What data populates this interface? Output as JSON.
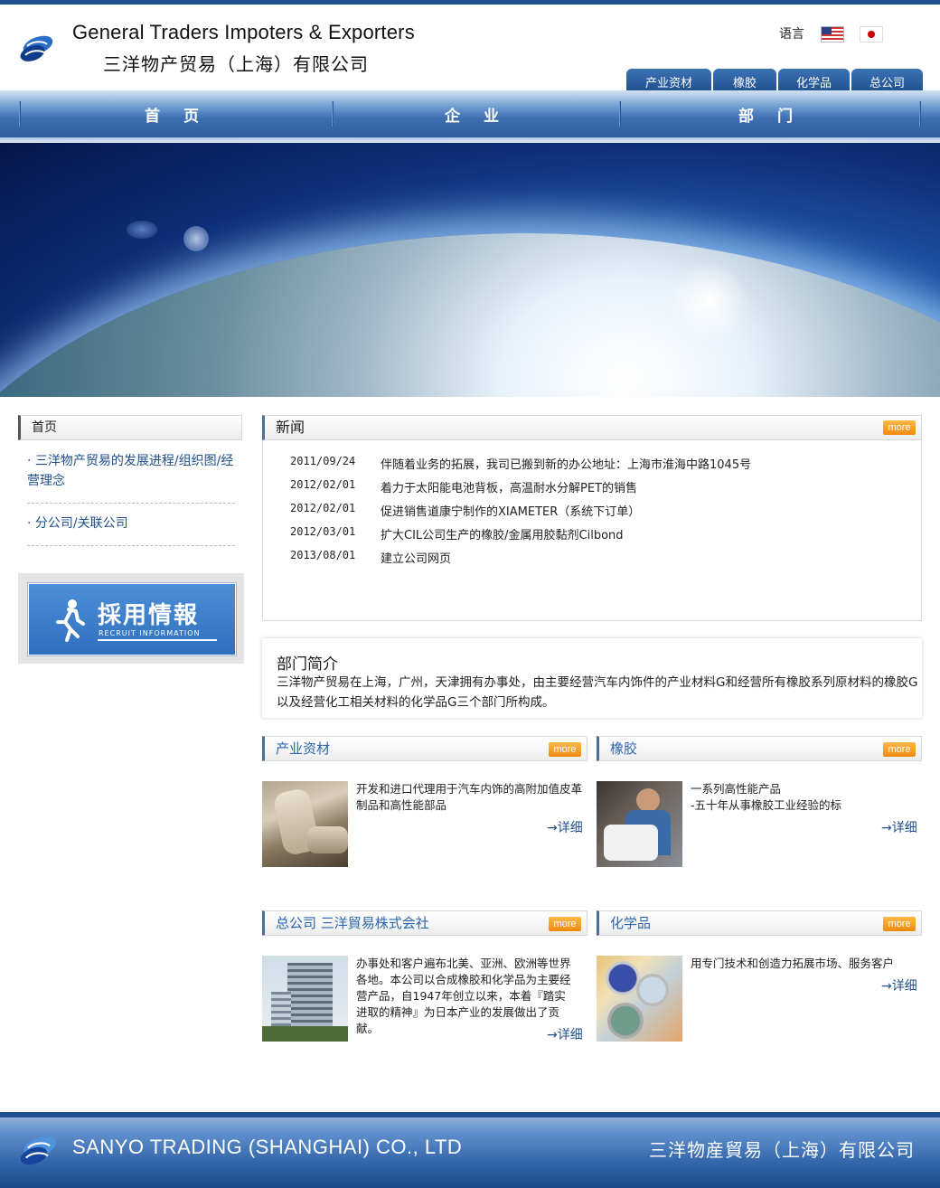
{
  "header": {
    "title_en": "General Traders Impoters & Exporters",
    "title_cn": "三洋物产贸易（上海）有限公司",
    "lang_label": "语言",
    "tabs": [
      "产业资材",
      "橡胶",
      "化学品",
      "总公司"
    ]
  },
  "nav": {
    "items": [
      "首 页",
      "企 业",
      "部 门"
    ]
  },
  "sidebar": {
    "heading": "首页",
    "links": [
      "· 三洋物产贸易的发展进程/组织图/经营理念",
      "· 分公司/关联公司"
    ],
    "recruit_title": "採用情報",
    "recruit_sub": "RECRUIT INFORMATION"
  },
  "news": {
    "heading": "新闻",
    "more": "more",
    "items": [
      {
        "date": "2011/09/24",
        "text": "伴随着业务的拓展，我司已搬到新的办公地址：上海市淮海中路1045号"
      },
      {
        "date": "2012/02/01",
        "text": "着力于太阳能电池背板，高温耐水分解PET的销售"
      },
      {
        "date": "2012/02/01",
        "text": "促进销售道康宁制作的XIAMETER（系统下订单）"
      },
      {
        "date": "2012/03/01",
        "text": "扩大CIL公司生产的橡胶/金属用胶黏剂Cilbond"
      },
      {
        "date": "2013/08/01",
        "text": "建立公司网页"
      }
    ]
  },
  "dept": {
    "title": "部门简介",
    "body": "三洋物产贸易在上海，广州，天津拥有办事处，由主要经营汽车内饰件的产业材料G和经营所有橡胶系列原材料的橡胶G以及经营化工相关材料的化学品G三个部门所构成。"
  },
  "sections": [
    {
      "title": "产业资材",
      "more": "more",
      "text": "开发和进口代理用于汽车内饰的高附加值皮革制品和高性能部品",
      "detail": "→详细"
    },
    {
      "title": "橡胶",
      "more": "more",
      "text": "一系列高性能产品\n-五十年从事橡胶工业经验的标",
      "detail": "→详细"
    },
    {
      "title": "总公司  三洋貿易株式会社",
      "more": "more",
      "text": "办事处和客户遍布北美、亚洲、欧洲等世界各地。本公司以合成橡胶和化学品为主要经营产品，自1947年创立以来，本着『踏实进取的精神』为日本产业的发展做出了贡献。",
      "detail": "→详细"
    },
    {
      "title": "化学品",
      "more": "more",
      "text": "用专门技术和创造力拓展市场、服务客户",
      "detail": "→详细"
    }
  ],
  "footer": {
    "en": "SANYO TRADING (SHANGHAI) CO., LTD",
    "cn": "三洋物産貿易（上海）有限公司"
  }
}
